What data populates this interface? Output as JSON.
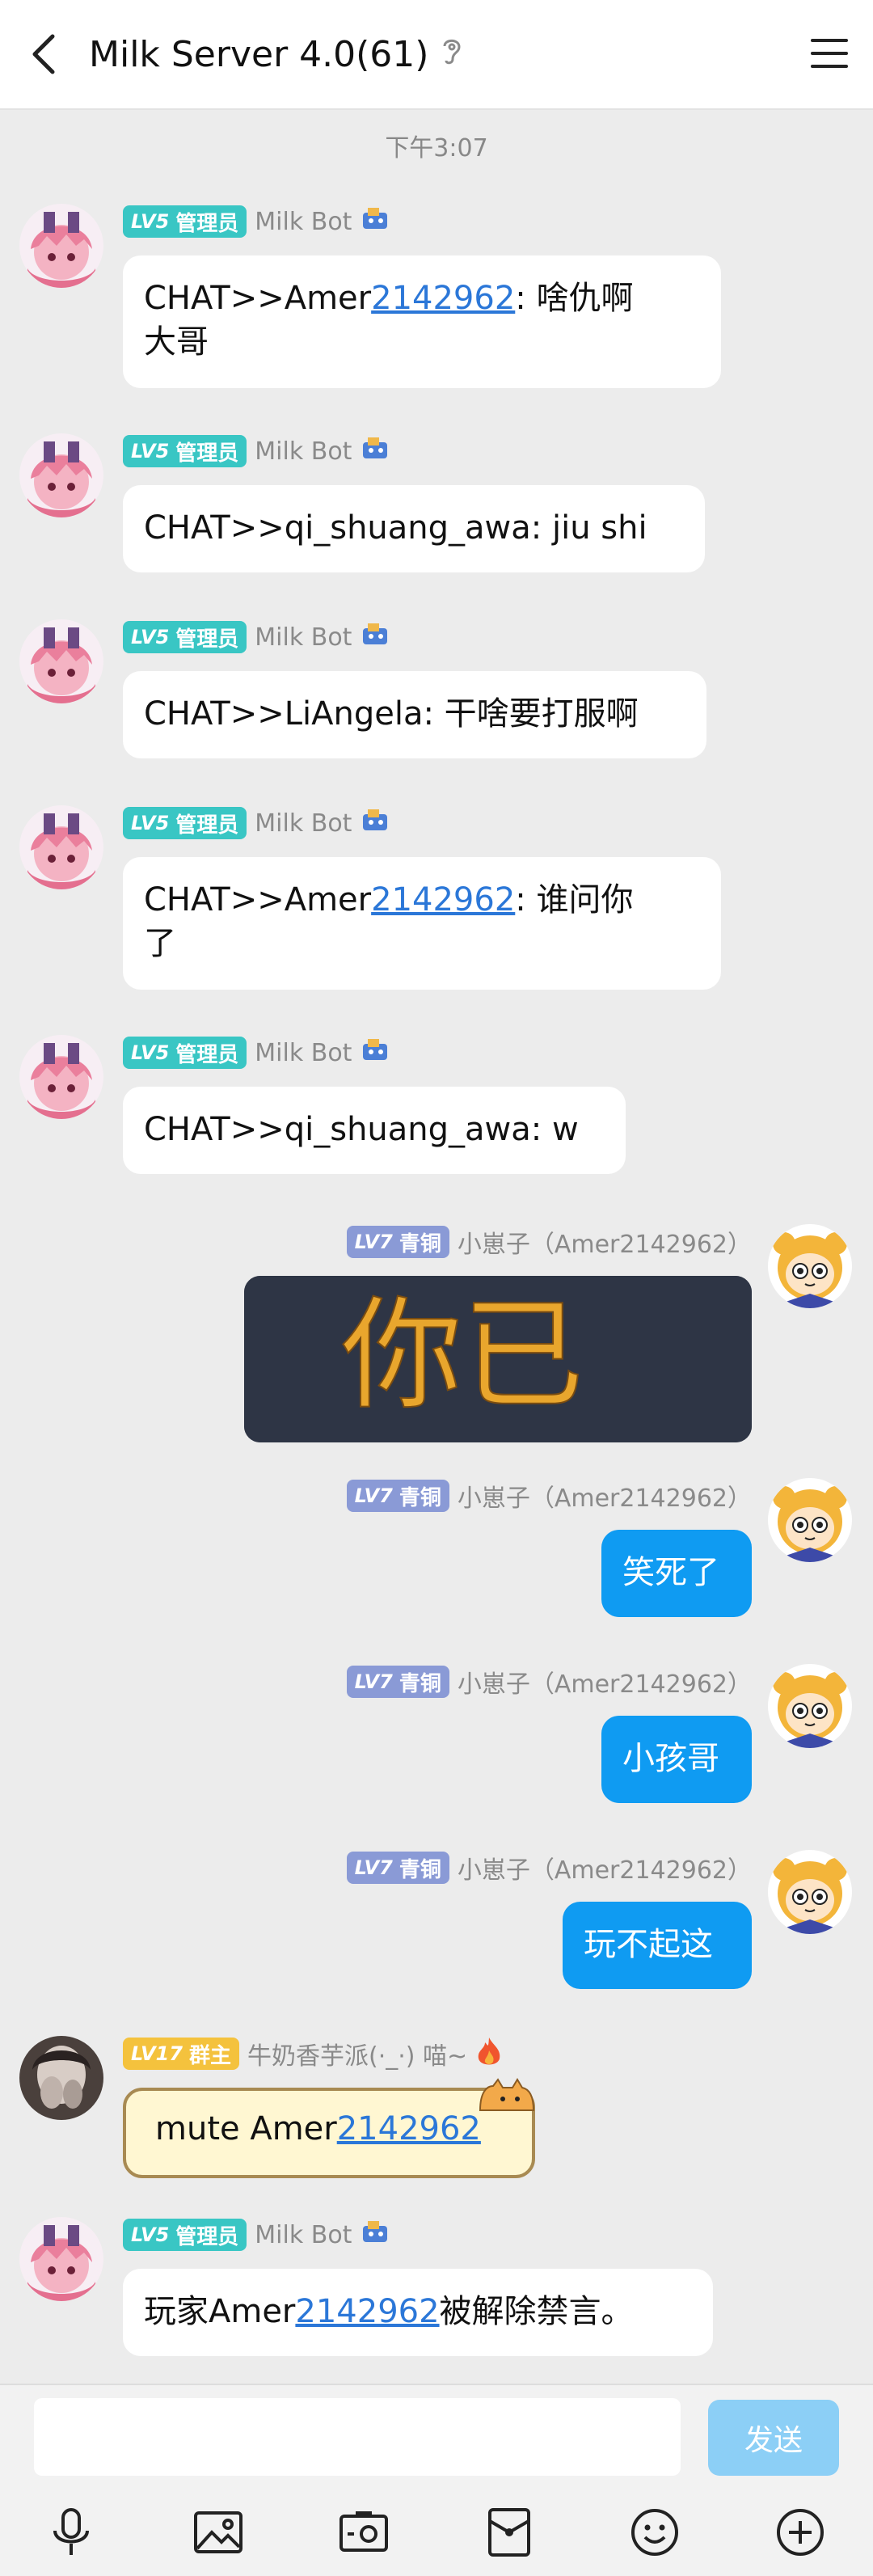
{
  "header": {
    "title": "Milk Server 4.0(61)"
  },
  "timestamp": "下午3:07",
  "badges": {
    "admin": {
      "lv": "LV5",
      "role": "管理员"
    },
    "bronze": {
      "lv": "LV7",
      "role": "青铜"
    },
    "owner": {
      "lv": "LV17",
      "role": "群主"
    }
  },
  "names": {
    "bot": "Milk Bot",
    "self": "小崽子（Amer2142962）",
    "owner": "牛奶香芋派(·_·) 喵~"
  },
  "messages": [
    {
      "pre": "CHAT>>Amer",
      "link": "2142962",
      "post": ": 啥仇啊",
      "line2": "大哥"
    },
    {
      "text": "CHAT>>qi_shuang_awa: jiu shi"
    },
    {
      "text": "CHAT>>LiAngela: 干啥要打服啊"
    },
    {
      "pre": "CHAT>>Amer",
      "link": "2142962",
      "post": ": 谁问你",
      "line2": "了"
    },
    {
      "text": "CHAT>>qi_shuang_awa: w"
    },
    {
      "image_text": "你已"
    },
    {
      "text": "笑死了"
    },
    {
      "text": "小孩哥"
    },
    {
      "text": "玩不起这"
    },
    {
      "pre": "mute Amer",
      "link": "2142962"
    },
    {
      "pre": "玩家Amer",
      "link": "2142962",
      "post": "被解除禁言。"
    }
  ],
  "input": {
    "value": "",
    "send_label": "发送"
  },
  "colors": {
    "accent": "#0f9bf2",
    "admin_badge": "#39c6c4",
    "bronze_badge": "#8a9ad6",
    "owner_badge": "#f4c23d"
  }
}
